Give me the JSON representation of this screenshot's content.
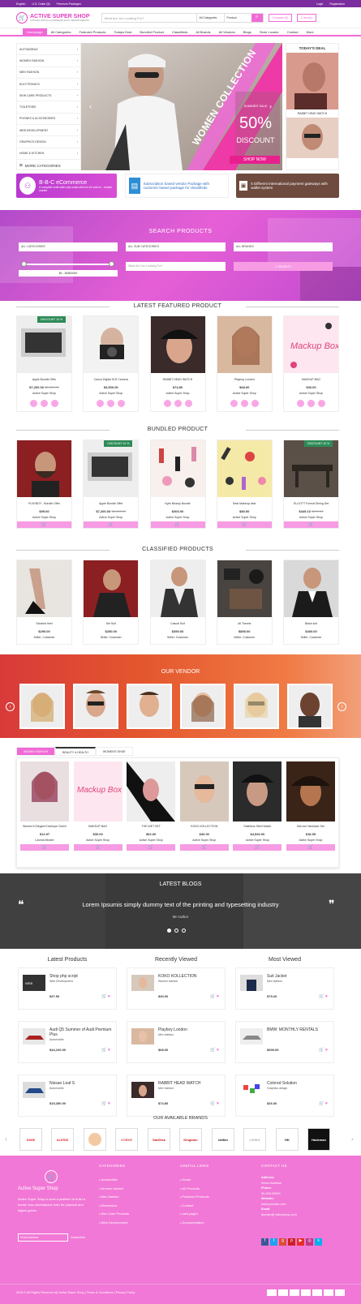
{
  "topbar": {
    "language": "English",
    "currency": "U.S. Dollar ($)",
    "premium": "Premium Packages",
    "login": "Login",
    "register": "Registration"
  },
  "header": {
    "logo_name": "ACTIVE SUPER SHOP",
    "logo_tag": "ULTIMATE VIRTUAL E-COMMERCE MULTI-VENDOR WEBSITE",
    "search_placeholder": "What Are You Looking For?",
    "category_select": "All Categories",
    "type_select": "Product",
    "compare": "Compare (0)",
    "cart": "0 item(s)"
  },
  "nav": [
    "Homepage",
    "All Categories",
    "Featured Products",
    "Todays Deal",
    "Bundled Product",
    "Classifieds",
    "All Brands",
    "All Vendors",
    "Blogs",
    "Store Locator",
    "Contact",
    "More"
  ],
  "categories": [
    "AUTOMOBILE",
    "WOMEN FASHION",
    "MEN FASHION",
    "ELECTRONICS",
    "SKIN CARE PRODUCTS",
    "TOILETRIES",
    "PHONES & ACCESSORIES",
    "WEB DEVELOPMENT",
    "GRAPHICS DESIGN",
    "HOME & KITCHEN"
  ],
  "more_categories": "MORE CATEGORIES",
  "hero": {
    "vertical": "WOMEN COLLECTION",
    "sale": "SUMMER SALE",
    "percent": "50%",
    "discount": "DISCOUNT",
    "button": "SHOP NOW"
  },
  "todays_deal": {
    "title": "TODAY'S DEAL",
    "item": "RABBIT HEAD WATCH"
  },
  "banners": {
    "b1_title": "B-B-C eCommerce",
    "b1_text": "A complete multi seller php script which is #1 sold on - envato market",
    "b2_text": "Subscription based vendor Package with customer based package for classifieds",
    "b3_text": "5 Different International payment gateways with wallet system"
  },
  "search_products": {
    "title": "SEARCH PRODUCTS",
    "cat": "ALL CATEGORIES",
    "subcat": "ALL SUB CATEGORIES",
    "brands": "ALL BRANDS",
    "range": "$0 - $4800000",
    "placeholder": "What Are You Looking For?",
    "button": "SEARCH"
  },
  "featured": {
    "title": "LATEST FEATURED PRODUCT",
    "items": [
      {
        "name": "Apple Bundle Offer",
        "price": "$7,200.00",
        "old": "$8,000.00",
        "seller": "Active Super Shop",
        "discount": "DISCOUNT 10 %"
      },
      {
        "name": "Canon Digital SLR Camera",
        "price": "$3,500.00",
        "old": "",
        "seller": "Active Super Shop",
        "discount": ""
      },
      {
        "name": "RABBIT HEAD WATCH",
        "price": "$74.80",
        "old": "",
        "seller": "Active Super Shop",
        "discount": ""
      },
      {
        "name": "Playboy London",
        "price": "$68.00",
        "old": "",
        "seller": "Active Super Shop",
        "discount": ""
      },
      {
        "name": "MAKEUP BAG",
        "price": "$30.00",
        "old": "",
        "seller": "Active Super Shop",
        "discount": ""
      }
    ]
  },
  "bundled": {
    "title": "BUNDLED PRODUCT",
    "items": [
      {
        "name": "PLAYBOY - Bundle Offer",
        "price": "$99.00",
        "old": "",
        "seller": "Active Super Shop",
        "discount": ""
      },
      {
        "name": "Apple Bundle Offer",
        "price": "$7,200.00",
        "old": "$8,000.00",
        "seller": "Active Super Shop",
        "discount": "DISCOUNT 10 %"
      },
      {
        "name": "Kylie Beauty Bundle",
        "price": "$300.00",
        "old": "",
        "seller": "Active Super Shop",
        "discount": ""
      },
      {
        "name": "Best Makeup deal",
        "price": "$80.00",
        "old": "",
        "seller": "Active Super Shop",
        "discount": ""
      },
      {
        "name": "ELLIOTT Formal Dining Set",
        "price": "$449.10",
        "old": "$499.00",
        "seller": "Active Super Shop",
        "discount": "DISCOUNT 10 %"
      }
    ]
  },
  "classified": {
    "title": "CLASSIFIED PRODUCTS",
    "items": [
      {
        "name": "Stocked heel",
        "price": "$290.00",
        "seller": "Seller: Customer"
      },
      {
        "name": "Set Suit",
        "price": "$250.00",
        "seller": "Seller: Customer"
      },
      {
        "name": "Casual Suit",
        "price": "$350.00",
        "seller": "Seller: Customer"
      },
      {
        "name": "All Travels",
        "price": "$850.00",
        "seller": "Seller: Customer"
      },
      {
        "name": "Black suit",
        "price": "$460.00",
        "seller": "Seller: Customer"
      }
    ]
  },
  "vendor": {
    "title": "OUR VENDOR"
  },
  "tabs": [
    "WOMEN FASHION",
    "BEAUTY & HEALTH",
    "WOMEN'S SHOE"
  ],
  "tab_items": [
    {
      "name": "Women's Elegant Envelope Clutch",
      "price": "$12.97",
      "seller": "Lavinia Mickee"
    },
    {
      "name": "MAKEUP BAG",
      "price": "$30.00",
      "seller": "Active Super Shop"
    },
    {
      "name": "THE WET SET",
      "price": "$62.00",
      "seller": "Active Super Shop"
    },
    {
      "name": "KOKO KOLLECTION",
      "price": "$40.00",
      "seller": "Active Super Shop"
    },
    {
      "name": "Stainless Steel Watch",
      "price": "$4,530.00",
      "seller": "Active Super Shop"
    },
    {
      "name": "BeLove Necklace Set",
      "price": "$18.95",
      "seller": "Active Super Shop"
    }
  ],
  "blogs": {
    "title": "LATEST BLOGS",
    "text": "Lorem Ipsumis simply dummy text of the printing and typesetting industry",
    "author": "Mr Author"
  },
  "latest_products": {
    "title": "Latest Products",
    "items": [
      {
        "name": "Shop php script",
        "cat": "Web Development",
        "price": "$37.50"
      },
      {
        "name": "Audi Q5 Summer of Audi Premium Plus",
        "cat": "Automobile",
        "price": "$44,100.00"
      },
      {
        "name": "Nissan Leaf S",
        "cat": "Automobile",
        "price": "$15,350.00"
      }
    ]
  },
  "recently_viewed": {
    "title": "Recently Viewed",
    "items": [
      {
        "name": "KOKO KOLLECTION",
        "cat": "Women fashion",
        "price": "$40.00"
      },
      {
        "name": "Playboy London",
        "cat": "Men fashion",
        "price": "$68.00"
      },
      {
        "name": "RABBIT HEAD WATCH",
        "cat": "Men fashion",
        "price": "$74.80"
      }
    ]
  },
  "most_viewed": {
    "title": "Most Viewed",
    "items": [
      {
        "name": "Suit Jacket",
        "cat": "Men fashion",
        "price": "$79.20"
      },
      {
        "name": "BMW: MONTHLY RENTALS",
        "cat": "",
        "price": "$909.09"
      },
      {
        "name": "Colored Solution",
        "cat": "Graphics design",
        "price": "$26.00"
      }
    ]
  },
  "brands": {
    "title": "OUR AVAILABLE BRANDS",
    "items": [
      "DIXIE",
      "ALESSI",
      "",
      "VOEKE",
      "SanDisk",
      "Kingston",
      "belkin",
      "LIVING",
      "HK",
      "Hackman"
    ]
  },
  "footer": {
    "brand": "Active Super Shop",
    "about": "Active Super Shop is such a platform to build a border less marketplace both for physical and digital goods.",
    "email_placeholder": "Email Address",
    "subscribe": "Subscribe",
    "categories_title": "CATEGORIES",
    "categories": [
      "Automobile",
      "Women fashion",
      "Men fashion",
      "Electronics",
      "Skin Care Products",
      "Web Development"
    ],
    "links_title": "USEFUL LINKS",
    "links": [
      "Home",
      "All Products",
      "Featured Products",
      "Contact",
      "new page1",
      "Documentation"
    ],
    "contact_title": "CONTACT US",
    "address_label": "Address:",
    "address": "Demo Address",
    "phone_label": "Phone:",
    "phone": "00-000-00000",
    "website_label": "Website:",
    "website": "www.yoursite.com",
    "email_label": "Email:",
    "email": "domain@ activeshop.com",
    "copyright": "2018 © All Rights Reserved @ Active Super Shop | Terms & Conditions | Privacy Policy"
  },
  "colors": {
    "pink": "#f06ad6",
    "purple": "#7b2c9e",
    "green": "#2e8b57"
  }
}
